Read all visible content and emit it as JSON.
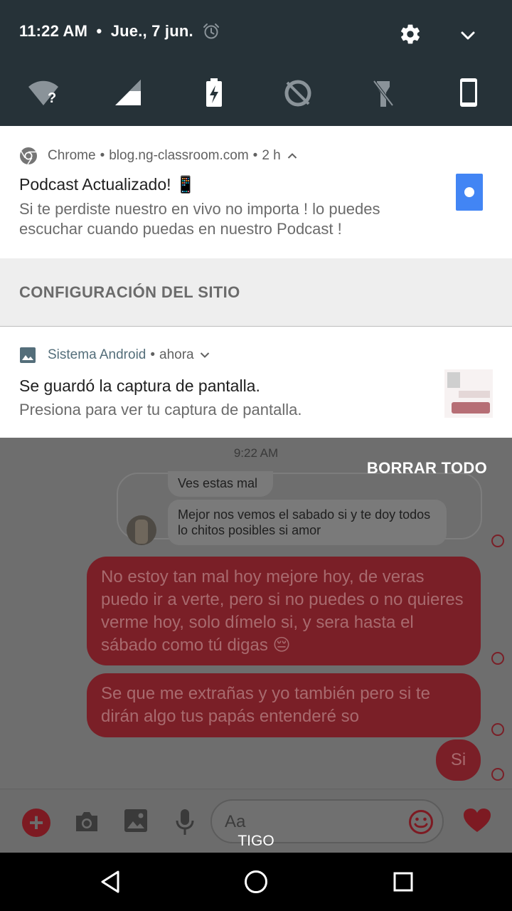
{
  "status_bar": {
    "time": "11:22 AM",
    "separator": "•",
    "date": "Jue., 7 jun.",
    "icons": [
      "alarm-icon",
      "settings-gear-icon",
      "expand-chevron-icon"
    ]
  },
  "quick_settings": {
    "tiles": [
      "wifi-unknown-icon",
      "cell-signal-icon",
      "battery-saver-icon",
      "data-saver-icon",
      "flashlight-off-icon",
      "phone-orientation-icon"
    ]
  },
  "notifications": [
    {
      "app": "Chrome",
      "sep1": "•",
      "source": "blog.ng-classroom.com",
      "sep2": "•",
      "time": "2 h",
      "title": "Podcast Actualizado! 📱",
      "body": "Si te perdiste nuestro en vivo  no importa ! lo puedes escuchar cuando puedas en nuestro Podcast !"
    },
    {
      "app": "Sistema Android",
      "sep1": "•",
      "time": "ahora",
      "title": "Se guardó la captura de pantalla.",
      "body": "Presiona para ver tu captura de pantalla."
    }
  ],
  "site_settings": {
    "label": "CONFIGURACIÓN DEL SITIO"
  },
  "clear_all": {
    "label": "BORRAR TODO"
  },
  "chat": {
    "time": "9:22 AM",
    "incoming": [
      "Ves estas mal",
      "Mejor nos vemos el sabado si y te doy todos lo chitos posibles si amor"
    ],
    "outgoing": [
      "No estoy tan mal hoy mejore hoy, de veras puedo ir a verte, pero si no puedes o no quieres verme hoy, solo dímelo  si, y sera hasta el sábado como tú digas 😔",
      "Se que me extrañas y yo también pero si te dirán algo tus papás entenderé so",
      "Si"
    ],
    "composer": {
      "placeholder": "Aa"
    },
    "colors": {
      "accent": "#7a1f27"
    }
  },
  "carrier": "TIGO",
  "nav_bar": {
    "buttons": [
      "back-icon",
      "home-icon",
      "recents-icon"
    ]
  }
}
